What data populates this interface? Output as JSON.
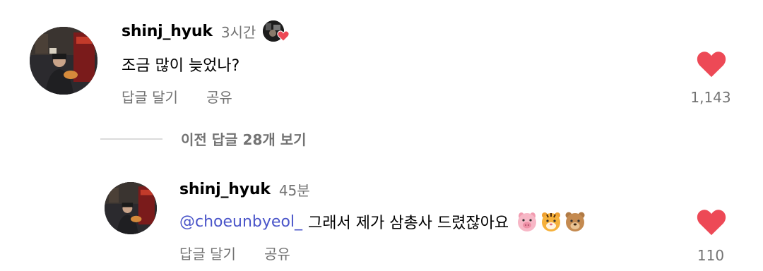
{
  "comment": {
    "username": "shinj_hyuk",
    "time": "3시간",
    "text": "조금 많이 늦었나?",
    "reply_label": "답글 달기",
    "share_label": "공유",
    "like_count": "1,143",
    "author_liked": true
  },
  "view_replies": {
    "label": "이전 답글 28개 보기"
  },
  "reply": {
    "username": "shinj_hyuk",
    "time": "45분",
    "mention": "@choeunbyeol_",
    "text": "그래서 제가 삼총사 드렸잖아요",
    "emojis": [
      "pig-face-emoji",
      "tiger-face-emoji",
      "bear-face-emoji"
    ],
    "reply_label": "답글 달기",
    "share_label": "공유",
    "like_count": "110"
  },
  "colors": {
    "heart": "#ed4956",
    "secondary_text": "#737373",
    "mention": "#4a55c9",
    "divider": "#dbdbdb"
  },
  "icons": {
    "like": "heart-icon",
    "author_like": "heart-icon"
  }
}
